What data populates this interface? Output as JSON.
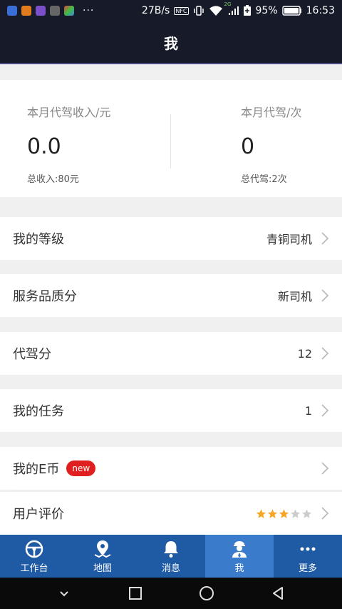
{
  "status_bar": {
    "net_speed": "27B/s",
    "battery": "95%",
    "time": "16:53",
    "nfc": "NFC",
    "network_type": "2G"
  },
  "header": {
    "title": "我"
  },
  "stats": {
    "left": {
      "label": "本月代驾收入/元",
      "value": "0.0",
      "sub": "总收入:80元"
    },
    "right": {
      "label": "本月代驾/次",
      "value": "0",
      "sub": "总代驾:2次"
    }
  },
  "menu": [
    {
      "label": "我的等级",
      "value": "青铜司机"
    },
    {
      "label": "服务品质分",
      "value": "新司机"
    },
    {
      "label": "代驾分",
      "value": "12"
    },
    {
      "label": "我的任务",
      "value": "1"
    },
    {
      "label": "我的E币",
      "badge": "new"
    },
    {
      "label": "用户评价",
      "rating": 3,
      "rating_max": 5
    }
  ],
  "tabs": [
    {
      "label": "工作台",
      "icon": "steering-wheel-icon"
    },
    {
      "label": "地图",
      "icon": "map-pin-icon"
    },
    {
      "label": "消息",
      "icon": "bell-icon"
    },
    {
      "label": "我",
      "icon": "driver-icon",
      "active": true
    },
    {
      "label": "更多",
      "icon": "more-dots-icon"
    }
  ],
  "colors": {
    "accent": "#1f5aa5",
    "active_tab": "#3b7bcb",
    "header": "#171b29",
    "badge": "#e02020",
    "star_on": "#f5a623",
    "star_off": "#cccccc"
  }
}
